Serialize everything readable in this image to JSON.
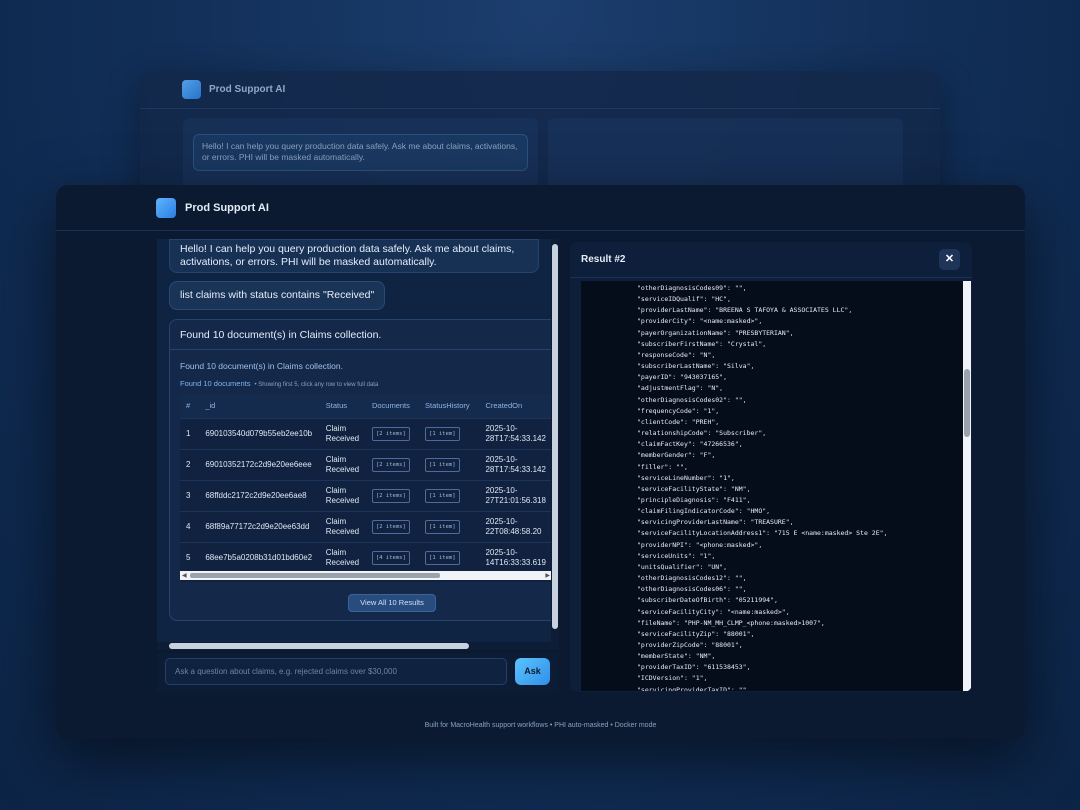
{
  "back_window": {
    "app_title": "Prod Support AI",
    "greeting": "Hello! I can help you query production data safely. Ask me about claims, activations, or errors. PHI will be masked automatically."
  },
  "app": {
    "title": "Prod Support AI"
  },
  "chat": {
    "greeting": "Hello! I can help you query production data safely. Ask me about claims, activations, or errors. PHI will be masked automatically.",
    "user_message": "list claims with status contains \"Received\"",
    "response_header": "Found 10 document(s) in Claims collection.",
    "response_subtitle": "Found 10 document(s) in Claims collection.",
    "docs_label": "Found 10 documents",
    "docs_hint": "• Showing first 5, click any row to view full data",
    "table": {
      "columns": [
        "#",
        "_id",
        "Status",
        "Documents",
        "StatusHistory",
        "CreatedOn"
      ],
      "rows": [
        {
          "num": "1",
          "id": "690103540d079b55eb2ee10b",
          "status": "Claim Received",
          "documents": "[2 items]",
          "history": "[1 item]",
          "created": "2025-10-28T17:54:33.142"
        },
        {
          "num": "2",
          "id": "69010352172c2d9e20ee6eee",
          "status": "Claim Received",
          "documents": "[2 items]",
          "history": "[1 item]",
          "created": "2025-10-28T17:54:33.142"
        },
        {
          "num": "3",
          "id": "68ffddc2172c2d9e20ee6ae8",
          "status": "Claim Received",
          "documents": "[2 items]",
          "history": "[1 item]",
          "created": "2025-10-27T21:01:56.318"
        },
        {
          "num": "4",
          "id": "68f89a77172c2d9e20ee63dd",
          "status": "Claim Received",
          "documents": "[2 items]",
          "history": "[1 item]",
          "created": "2025-10-22T08:48:58.20"
        },
        {
          "num": "5",
          "id": "68ee7b5a0208b31d01bd60e2",
          "status": "Claim Received",
          "documents": "[4 items]",
          "history": "[1 item]",
          "created": "2025-10-14T16:33:33.619"
        }
      ]
    },
    "view_all_label": "View All 10 Results"
  },
  "input": {
    "placeholder": "Ask a question about claims, e.g. rejected claims over $30,000",
    "ask_label": "Ask"
  },
  "result": {
    "title": "Result #2",
    "close_label": "✕",
    "lines": [
      "\"otherDiagnosisCodes09\": \"\",",
      "\"serviceIDQualif\": \"HC\",",
      "\"providerLastName\": \"BREENA S TAFOYA & ASSOCIATES LLC\",",
      "\"providerCity\": \"<name:masked>\",",
      "\"payerOrganizationName\": \"PRESBYTERIAN\",",
      "\"subscriberFirstName\": \"Crystal\",",
      "\"responseCode\": \"N\",",
      "\"subscriberLastName\": \"Silva\",",
      "\"payerID\": \"943037165\",",
      "\"adjustmentFlag\": \"N\",",
      "\"otherDiagnosisCodes02\": \"\",",
      "\"frequencyCode\": \"1\",",
      "\"clientCode\": \"PREH\",",
      "\"relationshipCode\": \"Subscriber\",",
      "\"claimFactKey\": \"47266536\",",
      "\"memberGender\": \"F\",",
      "\"filler\": \"\",",
      "\"serviceLineNumber\": \"1\",",
      "\"serviceFacilityState\": \"NM\",",
      "\"principleDiagnosis\": \"F411\",",
      "\"claimFilingIndicatorCode\": \"HMO\",",
      "\"servicingProviderLastName\": \"TREASURE\",",
      "\"serviceFacilityLocationAddress1\": \"715 E <name:masked> Ste 2E\",",
      "\"providerNPI\": \"<phone:masked>\",",
      "\"serviceUnits\": \"1\",",
      "\"unitsQualifier\": \"UN\",",
      "\"otherDiagnosisCodes12\": \"\",",
      "\"otherDiagnosisCodes06\": \"\",",
      "\"subscriberDateOfBirth\": \"05211994\",",
      "\"serviceFacilityCity\": \"<name:masked>\",",
      "\"fileName\": \"PHP-NM_MH_CLMP_<phone:masked>1007\",",
      "\"serviceFacilityZip\": \"88001\",",
      "\"providerZipCode\": \"88001\",",
      "\"memberState\": \"NM\",",
      "\"providerTaxID\": \"611538453\",",
      "\"ICDVersion\": \"1\",",
      "\"servicingProviderTaxID\": \"\","
    ]
  },
  "footer": "Built for MacroHealth support workflows • PHI auto-masked • Docker mode"
}
